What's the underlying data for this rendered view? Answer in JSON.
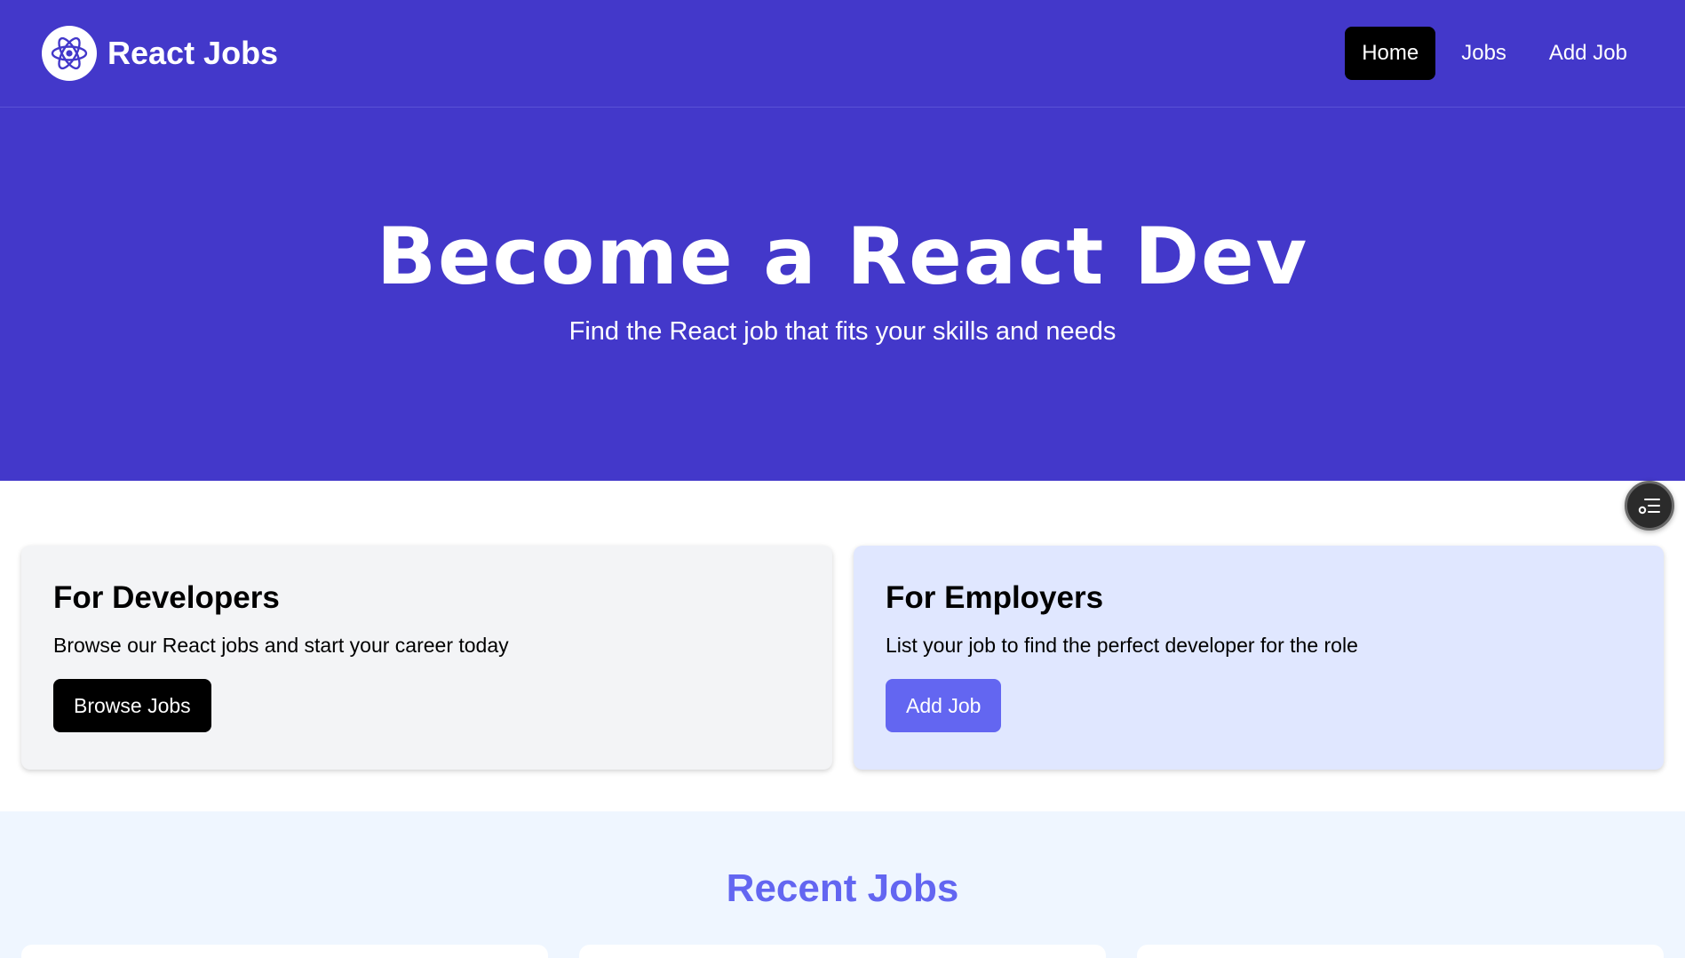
{
  "header": {
    "brand": "React Jobs",
    "logo_icon": "react-atom-icon",
    "nav": [
      {
        "label": "Home",
        "active": true
      },
      {
        "label": "Jobs",
        "active": false
      },
      {
        "label": "Add Job",
        "active": false
      }
    ]
  },
  "hero": {
    "title": "Become a React Dev",
    "subtitle": "Find the React job that fits your skills and needs"
  },
  "cards": {
    "developers": {
      "title": "For Developers",
      "text": "Browse our React jobs and start your career today",
      "button": "Browse Jobs"
    },
    "employers": {
      "title": "For Employers",
      "text": "List your job to find the perfect developer for the role",
      "button": "Add Job"
    }
  },
  "recent": {
    "title": "Recent Jobs"
  },
  "floating_button_icon": "list-filter-icon",
  "colors": {
    "primary": "#4338ca",
    "accent": "#6366f1",
    "dev_card_bg": "#f3f4f6",
    "emp_card_bg": "#e0e7ff",
    "recent_bg": "#eff6ff"
  }
}
